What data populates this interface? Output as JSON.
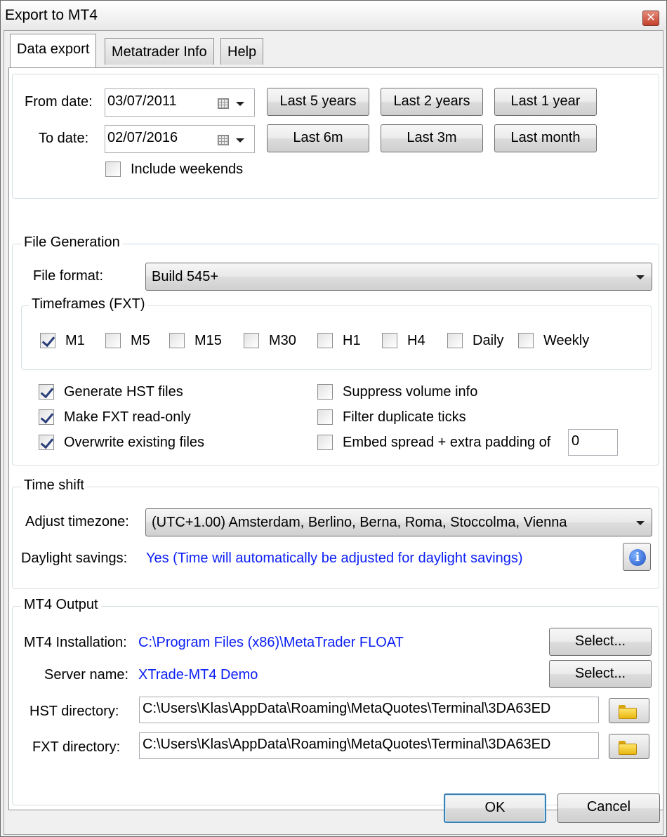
{
  "window": {
    "title": "Export to MT4",
    "close_label": "✕"
  },
  "tabs": [
    {
      "label": "Data export",
      "active": true
    },
    {
      "label": "Metatrader Info",
      "active": false
    },
    {
      "label": "Help",
      "active": false
    }
  ],
  "dates": {
    "from_label": "From date:",
    "from_value": "03/07/2011",
    "to_label": "To date:",
    "to_value": "02/07/2016",
    "quick_buttons": [
      "Last 5 years",
      "Last 2 years",
      "Last 1 year",
      "Last 6m",
      "Last 3m",
      "Last month"
    ],
    "include_weekends_label": "Include weekends",
    "include_weekends_checked": false
  },
  "file_generation": {
    "legend": "File Generation",
    "format_label": "File format:",
    "format_value": "Build 545+",
    "timeframes_legend": "Timeframes (FXT)",
    "timeframes": [
      {
        "label": "M1",
        "checked": true
      },
      {
        "label": "M5",
        "checked": false
      },
      {
        "label": "M15",
        "checked": false
      },
      {
        "label": "M30",
        "checked": false
      },
      {
        "label": "H1",
        "checked": false
      },
      {
        "label": "H4",
        "checked": false
      },
      {
        "label": "Daily",
        "checked": false
      },
      {
        "label": "Weekly",
        "checked": false
      }
    ],
    "options_left": [
      {
        "label": "Generate HST files",
        "checked": true
      },
      {
        "label": "Make FXT read-only",
        "checked": true
      },
      {
        "label": "Overwrite existing files",
        "checked": true
      }
    ],
    "options_right": [
      {
        "label": "Suppress volume info",
        "checked": false
      },
      {
        "label": "Filter duplicate ticks",
        "checked": false
      },
      {
        "label": "Embed spread + extra padding of",
        "checked": false
      }
    ],
    "padding_value": "0"
  },
  "time_shift": {
    "legend": "Time shift",
    "timezone_label": "Adjust timezone:",
    "timezone_value": "(UTC+1.00) Amsterdam, Berlino, Berna, Roma, Stoccolma, Vienna",
    "daylight_label": "Daylight savings:",
    "daylight_value": "Yes (Time will automatically be adjusted for daylight savings)",
    "info_glyph": "i"
  },
  "mt4_output": {
    "legend": "MT4 Output",
    "installation_label": "MT4 Installation:",
    "installation_value": "C:\\Program Files (x86)\\MetaTrader FLOAT",
    "server_label": "Server name:",
    "server_value": "XTrade-MT4 Demo",
    "select_label": "Select...",
    "hst_label": "HST directory:",
    "hst_value": "C:\\Users\\Klas\\AppData\\Roaming\\MetaQuotes\\Terminal\\3DA63ED",
    "fxt_label": "FXT directory:",
    "fxt_value": "C:\\Users\\Klas\\AppData\\Roaming\\MetaQuotes\\Terminal\\3DA63ED"
  },
  "footer": {
    "ok_label": "OK",
    "cancel_label": "Cancel"
  },
  "colors": {
    "link_blue": "#0a1ef5",
    "default_button_border": "#3c7fb1"
  }
}
